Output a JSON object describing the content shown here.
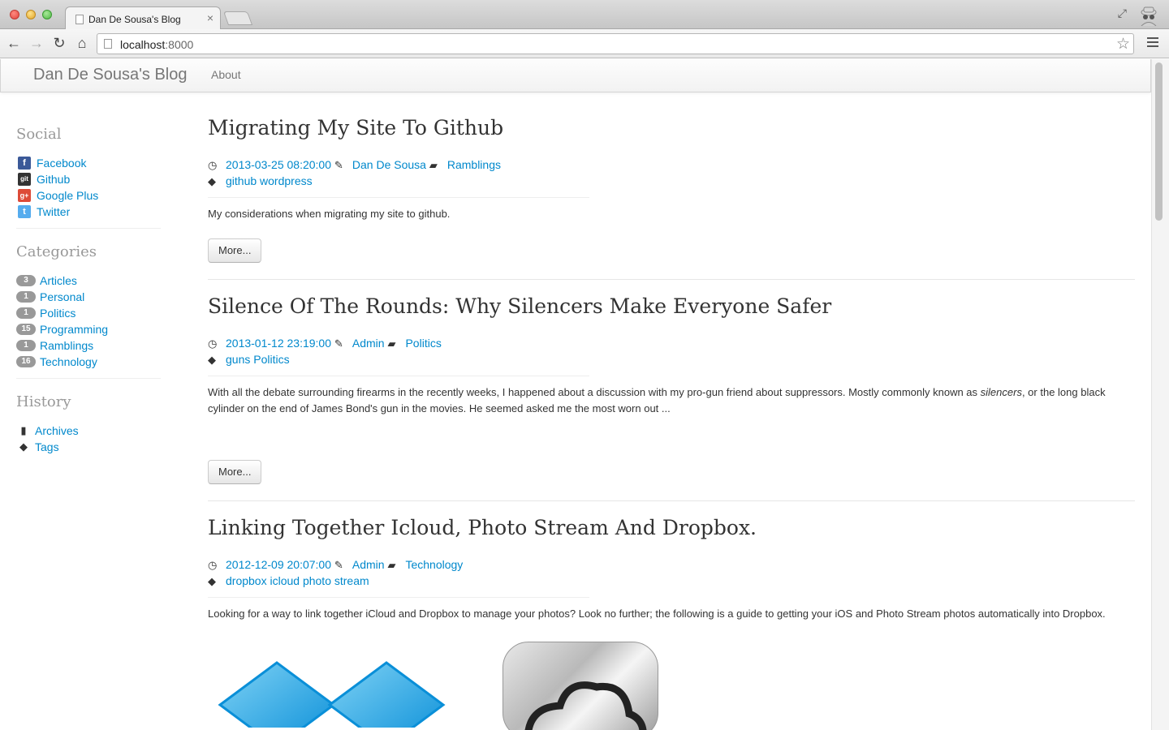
{
  "browser": {
    "tab_title": "Dan De Sousa's Blog",
    "tab_close": "×",
    "url_host": "localhost",
    "url_port": ":8000"
  },
  "navbar": {
    "brand": "Dan De Sousa's Blog",
    "about": "About"
  },
  "sidebar": {
    "social": {
      "heading": "Social",
      "items": [
        {
          "label": "Facebook",
          "icon": "facebook-icon"
        },
        {
          "label": "Github",
          "icon": "github-icon"
        },
        {
          "label": "Google Plus",
          "icon": "google-plus-icon"
        },
        {
          "label": "Twitter",
          "icon": "twitter-icon"
        }
      ]
    },
    "categories": {
      "heading": "Categories",
      "items": [
        {
          "count": "3",
          "label": "Articles"
        },
        {
          "count": "1",
          "label": "Personal"
        },
        {
          "count": "1",
          "label": "Politics"
        },
        {
          "count": "15",
          "label": "Programming"
        },
        {
          "count": "1",
          "label": "Ramblings"
        },
        {
          "count": "16",
          "label": "Technology"
        }
      ]
    },
    "history": {
      "heading": "History",
      "items": [
        {
          "label": "Archives",
          "icon": "book-icon"
        },
        {
          "label": "Tags",
          "icon": "tags-icon"
        }
      ]
    }
  },
  "articles": [
    {
      "title": "Migrating My Site To Github",
      "date": "2013-03-25 08:20:00",
      "author": "Dan De Sousa",
      "category": "Ramblings",
      "tags": "github wordpress",
      "summary": "My considerations when migrating my site to github.",
      "more": "More..."
    },
    {
      "title": "Silence Of The Rounds: Why Silencers Make Everyone Safer",
      "date": "2013-01-12 23:19:00",
      "author": "Admin",
      "category": "Politics",
      "tags": "guns Politics",
      "summary_before": "With all the debate surrounding firearms in the recently weeks, I happened about a discussion with my pro-gun friend about suppressors. Mostly commonly known as ",
      "summary_em": "silencers",
      "summary_after": ", or the long black cylinder on the end of James Bond's gun in the movies. He seemed asked me the most worn out ...",
      "more": "More..."
    },
    {
      "title": "Linking Together Icloud, Photo Stream And Dropbox.",
      "date": "2012-12-09 20:07:00",
      "author": "Admin",
      "category": "Technology",
      "tags": "dropbox icloud photo stream",
      "summary": "Looking for a way to link together iCloud and Dropbox to manage your photos? Look no further; the following is a guide to getting your iOS and Photo Stream photos automatically into Dropbox."
    }
  ],
  "colors": {
    "link": "#0088cc",
    "badge": "#999999",
    "heading_muted": "#999999"
  }
}
